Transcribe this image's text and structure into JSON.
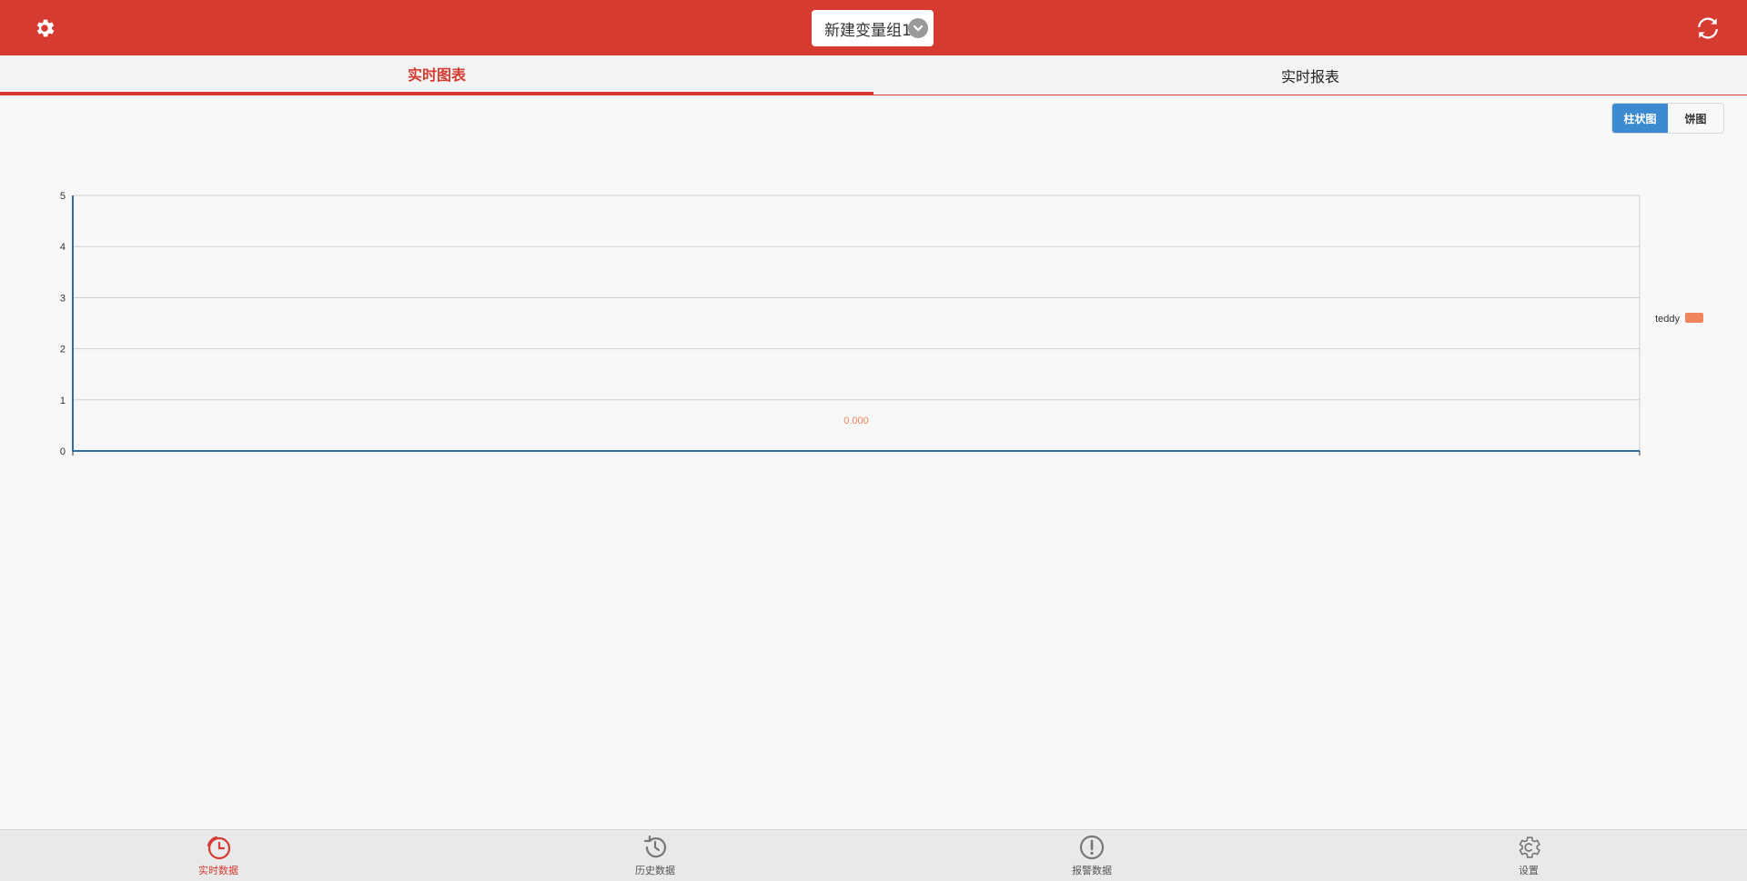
{
  "header": {
    "group_name": "新建变量组1",
    "bg_color": "#d53b31"
  },
  "tabs": [
    {
      "label": "实时图表",
      "active": true
    },
    {
      "label": "实时报表",
      "active": false
    }
  ],
  "chart_toggle": {
    "options": [
      {
        "label": "柱状图",
        "active": true
      },
      {
        "label": "饼图",
        "active": false
      }
    ]
  },
  "chart_data": {
    "type": "bar",
    "categories": [
      ""
    ],
    "series": [
      {
        "name": "teddy",
        "values": [
          0.0
        ],
        "color": "#f0845b"
      }
    ],
    "data_labels": [
      "0.000"
    ],
    "y_ticks": [
      "0",
      "1",
      "2",
      "3",
      "4",
      "5"
    ],
    "ylim": [
      0,
      5
    ],
    "grid": true,
    "legend_position": "right"
  },
  "bottom_nav": [
    {
      "label": "实时数据",
      "icon": "clock-icon",
      "active": true
    },
    {
      "label": "历史数据",
      "icon": "history-icon",
      "active": false
    },
    {
      "label": "报警数据",
      "icon": "alert-icon",
      "active": false
    },
    {
      "label": "设置",
      "icon": "gear-icon",
      "active": false
    }
  ]
}
